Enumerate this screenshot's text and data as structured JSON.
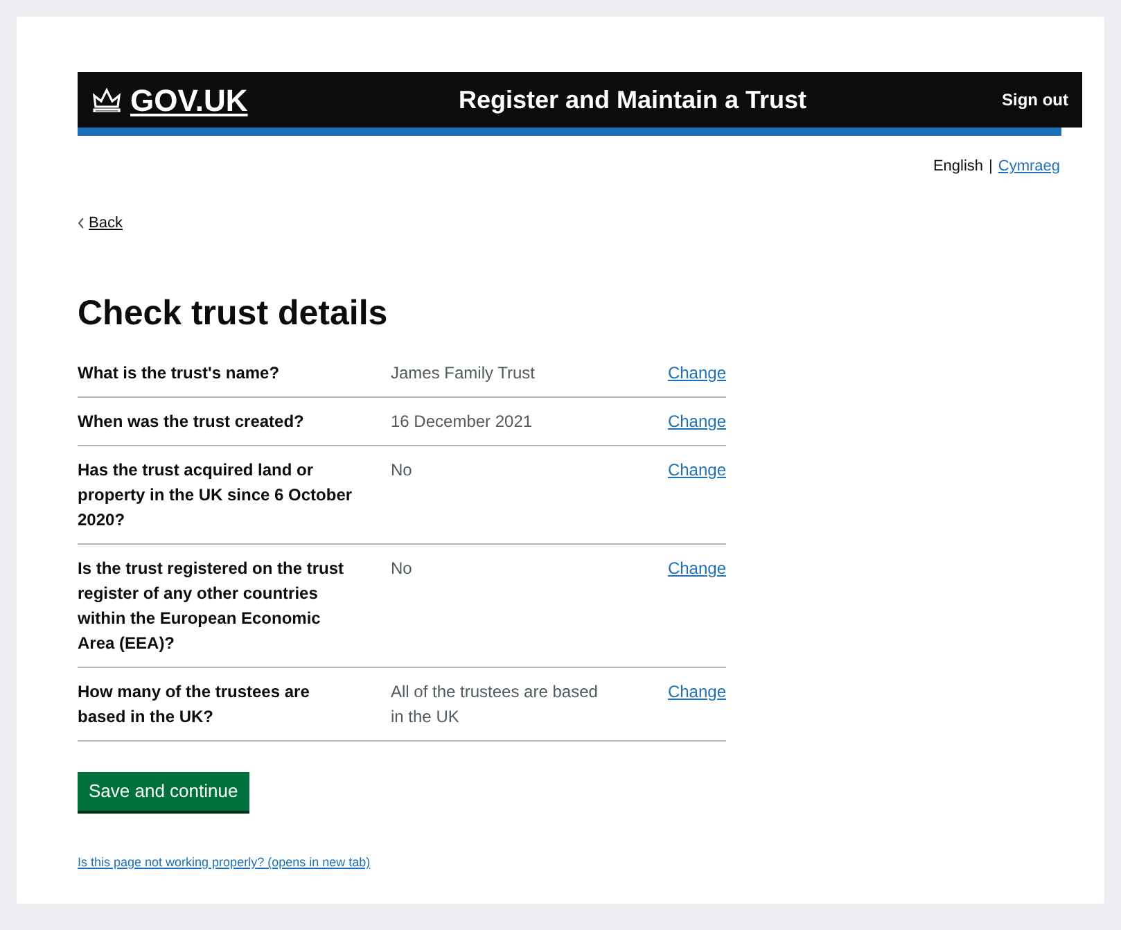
{
  "header": {
    "logo": "GOV.UK",
    "service": "Register and Maintain a Trust",
    "sign_out": "Sign out"
  },
  "language": [
    {
      "label": "English",
      "selected": true
    },
    {
      "label": "Cymraeg",
      "selected": false
    }
  ],
  "language_separator": "|",
  "back": "Back",
  "heading": "Check trust details",
  "rows": [
    {
      "key": "What is the trust's name?",
      "value": "James Family Trust",
      "action": "Change"
    },
    {
      "key": "When was the trust created?",
      "value": "16 December 2021",
      "action": "Change"
    },
    {
      "key": "Has the trust acquired land or property in the UK since 6 October 2020?",
      "value": "No",
      "action": "Change"
    },
    {
      "key": "Is the trust registered on the trust register of any other countries within the European Economic Area (EEA)?",
      "value": "No",
      "action": "Change"
    },
    {
      "key": "How many of the trustees are based in the UK?",
      "value": "All of the trustees are based in the UK",
      "action": "Change"
    }
  ],
  "button": "Save and continue",
  "help_link": "Is this page not working properly? (opens in new tab)"
}
